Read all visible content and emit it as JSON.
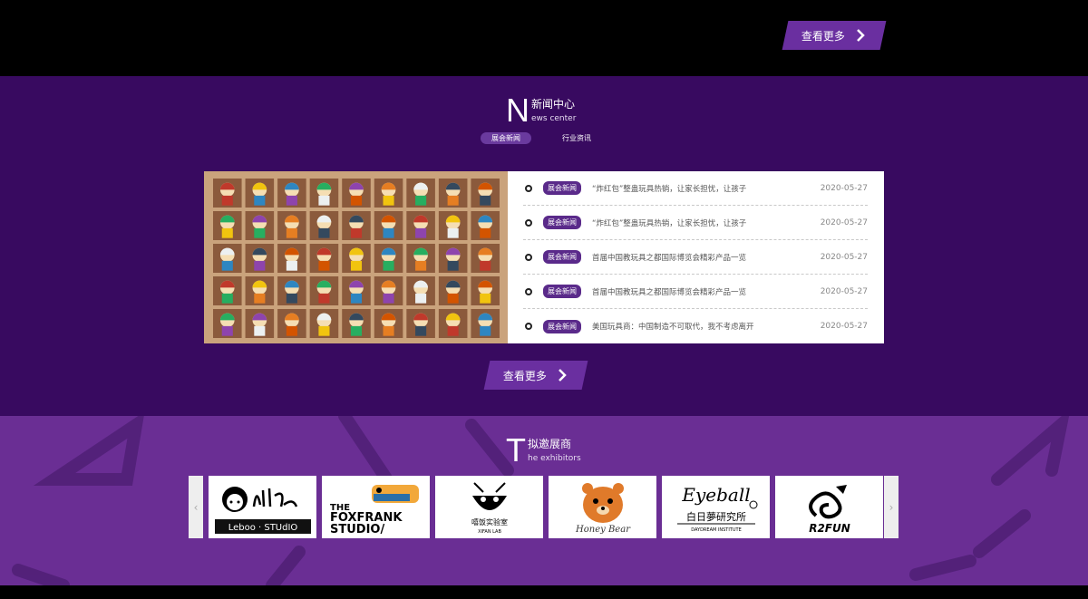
{
  "top": {
    "more_label": "查看更多"
  },
  "news": {
    "letter": "N",
    "title_cn": "新闻中心",
    "title_en": "ews center",
    "tabs": [
      {
        "label": "展会新闻",
        "active": true
      },
      {
        "label": "行业资讯",
        "active": false
      }
    ],
    "items": [
      {
        "badge": "展会新闻",
        "title": "“炸红包”整蛊玩具热销，让家长担忧，让孩子",
        "date": "2020-05-27"
      },
      {
        "badge": "展会新闻",
        "title": "“炸红包”整蛊玩具热销，让家长担忧，让孩子",
        "date": "2020-05-27"
      },
      {
        "badge": "展会新闻",
        "title": "首届中国教玩具之都国际博览会精彩产品一览",
        "date": "2020-05-27"
      },
      {
        "badge": "展会新闻",
        "title": "首届中国教玩具之都国际博览会精彩产品一览",
        "date": "2020-05-27"
      },
      {
        "badge": "展会新闻",
        "title": "美国玩具商：中国制造不可取代，我不考虑离开",
        "date": "2020-05-27"
      }
    ],
    "more_label": "查看更多"
  },
  "exhibitors": {
    "letter": "T",
    "title_cn": "拟邀展商",
    "title_en": "he exhibitors",
    "logos": [
      {
        "name": "Lilla",
        "sub": "Leboo · STUdIO"
      },
      {
        "name": "THE FOXFRANK STUDIO/",
        "line1": "THE",
        "line2": "FOXFRANK",
        "line3": "STUDIO/"
      },
      {
        "name": "嘻饭实验室",
        "sub": "XIFAN LAB"
      },
      {
        "name": "Honey Bear"
      },
      {
        "name": "Eyeball",
        "cn": "白日夢研究所",
        "en": "DAYDREAM INSTITUTE"
      },
      {
        "name": "R2FUN"
      }
    ]
  },
  "colors": {
    "accent": "#6a2fa0",
    "news_bg": "#380a60",
    "exhibitors_bg": "#6a2e94",
    "badge": "#5a2a8a"
  }
}
